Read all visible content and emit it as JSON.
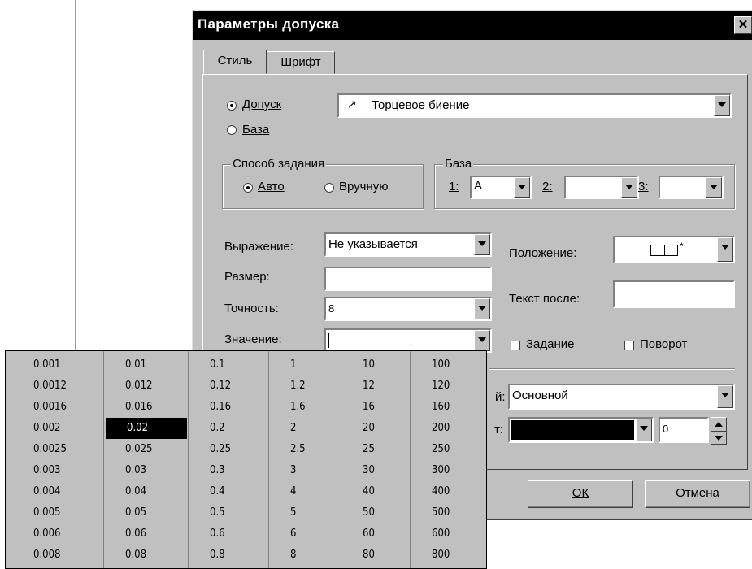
{
  "dialog": {
    "title": "Параметры допуска",
    "close_glyph": "✕",
    "tabs": [
      "Стиль",
      "Шрифт"
    ],
    "tolerance_radio": "Допуск",
    "base_radio": "База",
    "tolerance_type": "Торцевое биение",
    "method_group": {
      "title": "Способ задания",
      "auto": "Авто",
      "manual": "Вручную"
    },
    "base_group": {
      "title": "База",
      "l1": "1:",
      "v1": "A",
      "l2": "2:",
      "v2": "",
      "l3": "3:",
      "v3": ""
    },
    "expression_label": "Выражение:",
    "expression_value": "Не указывается",
    "size_label": "Размер:",
    "size_value": "",
    "precision_label": "Точность:",
    "precision_value": "8",
    "value_label": "Значение:",
    "value_value": "",
    "position_label": "Положение:",
    "text_after_label": "Текст после:",
    "text_after_value": "",
    "task_checkbox": "Задание",
    "rotate_checkbox": "Поворот",
    "layer_label_fragment": "й:",
    "layer_value": "Основной",
    "color_label_fragment": "т:",
    "width_value": "0",
    "ok_button": "ОК",
    "cancel_button": "Отмена"
  },
  "value_list": {
    "columns": [
      [
        "0.001",
        "0.0012",
        "0.0016",
        "0.002",
        "0.0025",
        "0.003",
        "0.004",
        "0.005",
        "0.006",
        "0.008"
      ],
      [
        "0.01",
        "0.012",
        "0.016",
        "0.02",
        "0.025",
        "0.03",
        "0.04",
        "0.05",
        "0.06",
        "0.08"
      ],
      [
        "0.1",
        "0.12",
        "0.16",
        "0.2",
        "0.25",
        "0.3",
        "0.4",
        "0.5",
        "0.6",
        "0.8"
      ],
      [
        "1",
        "1.2",
        "1.6",
        "2",
        "2.5",
        "3",
        "4",
        "5",
        "6",
        "8"
      ],
      [
        "10",
        "12",
        "16",
        "20",
        "25",
        "30",
        "40",
        "50",
        "60",
        "80"
      ],
      [
        "100",
        "120",
        "160",
        "200",
        "250",
        "300",
        "400",
        "500",
        "600",
        "800"
      ]
    ],
    "selected_value": "0.02"
  },
  "colors": {
    "dialog_bg": "#c0c0c0",
    "titlebar": "#000000",
    "selection": "#000000"
  }
}
